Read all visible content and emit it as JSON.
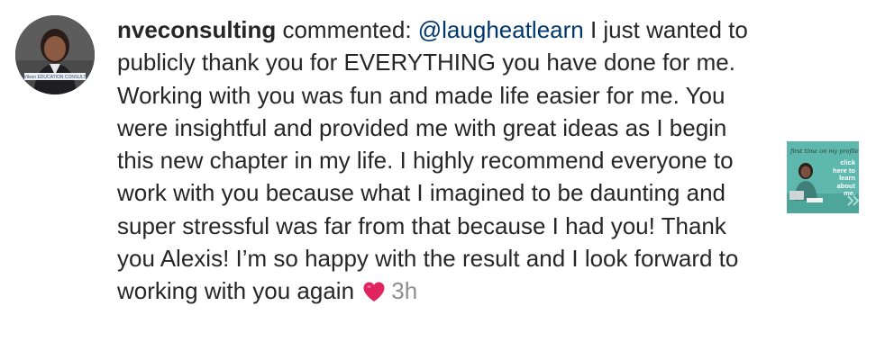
{
  "notification": {
    "username": "nveconsulting",
    "action_text": " commented: ",
    "mention": "@laugheatlearn",
    "comment_body": " I just wanted to publicly thank you for EVERYTHING you have done for me. Working with you was fun and made life easier for me. You were insightful and provided me with great ideas as I begin this new chapter in my life. I highly recommend everyone to work with you because what I imagined to be daunting and super stressful was far from that because I had you! Thank you Alexis! I’m so happy with the result and I look forward to working with you again ",
    "timestamp": "3h",
    "avatar_logo_text": "Nia Vilson EDUCATION CONSULTING",
    "heart_icon": "red-heart-icon",
    "heart_color": "#e0245e"
  },
  "post_thumbnail": {
    "caption": "first time on my profile?",
    "cta": "click here to learn about me.",
    "background_color": "#5fb8ad"
  }
}
